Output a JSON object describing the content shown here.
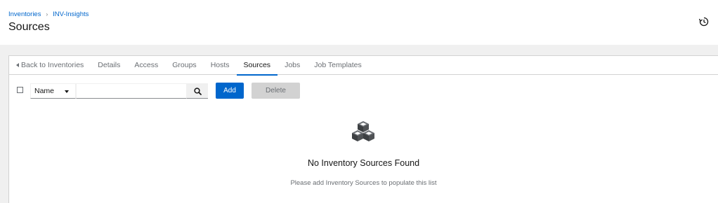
{
  "breadcrumb": {
    "items": [
      "Inventories",
      "INV-Insights"
    ],
    "separator": "›"
  },
  "header": {
    "title": "Sources",
    "history_icon": "history-icon"
  },
  "tabs": [
    {
      "label": "Back to Inventories",
      "icon": "caret-left-icon",
      "active": false
    },
    {
      "label": "Details",
      "active": false
    },
    {
      "label": "Access",
      "active": false
    },
    {
      "label": "Groups",
      "active": false
    },
    {
      "label": "Hosts",
      "active": false
    },
    {
      "label": "Sources",
      "active": true
    },
    {
      "label": "Jobs",
      "active": false
    },
    {
      "label": "Job Templates",
      "active": false
    }
  ],
  "toolbar": {
    "filter_value": "Name",
    "search_value": "",
    "search_icon": "search-icon",
    "add_label": "Add",
    "delete_label": "Delete"
  },
  "empty_state": {
    "icon": "cubes-icon",
    "title": "No Inventory Sources Found",
    "body": "Please add Inventory Sources to populate this list"
  },
  "colors": {
    "accent": "#0066cc",
    "background": "#f0f0f0",
    "disabled": "#d2d2d2"
  }
}
